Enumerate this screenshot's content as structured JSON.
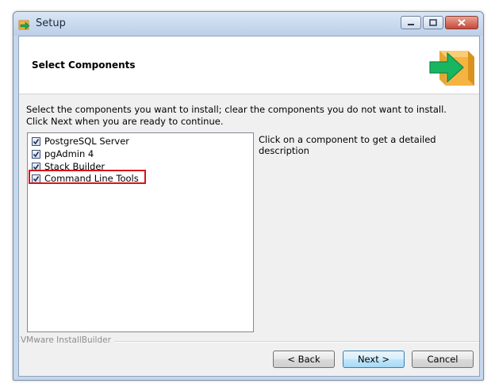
{
  "window": {
    "title": "Setup",
    "controls": {
      "minimize_icon": "minimize-icon",
      "maximize_icon": "maximize-icon",
      "close_icon": "close-icon"
    }
  },
  "header": {
    "title": "Select Components",
    "logo_icon": "installer-box-arrow-icon"
  },
  "body": {
    "instruction": "Select the components you want to install; clear the components you do not want to install. Click Next when you are ready to continue.",
    "components": [
      {
        "label": "PostgreSQL Server",
        "checked": true
      },
      {
        "label": "pgAdmin 4",
        "checked": true
      },
      {
        "label": "Stack Builder",
        "checked": true
      },
      {
        "label": "Command Line Tools",
        "checked": true
      }
    ],
    "description": "Click on a component to get a detailed description",
    "highlight_color": "#d8141b"
  },
  "footer": {
    "vendor": "VMware InstallBuilder",
    "back_label": "< Back",
    "next_label": "Next >",
    "cancel_label": "Cancel"
  }
}
